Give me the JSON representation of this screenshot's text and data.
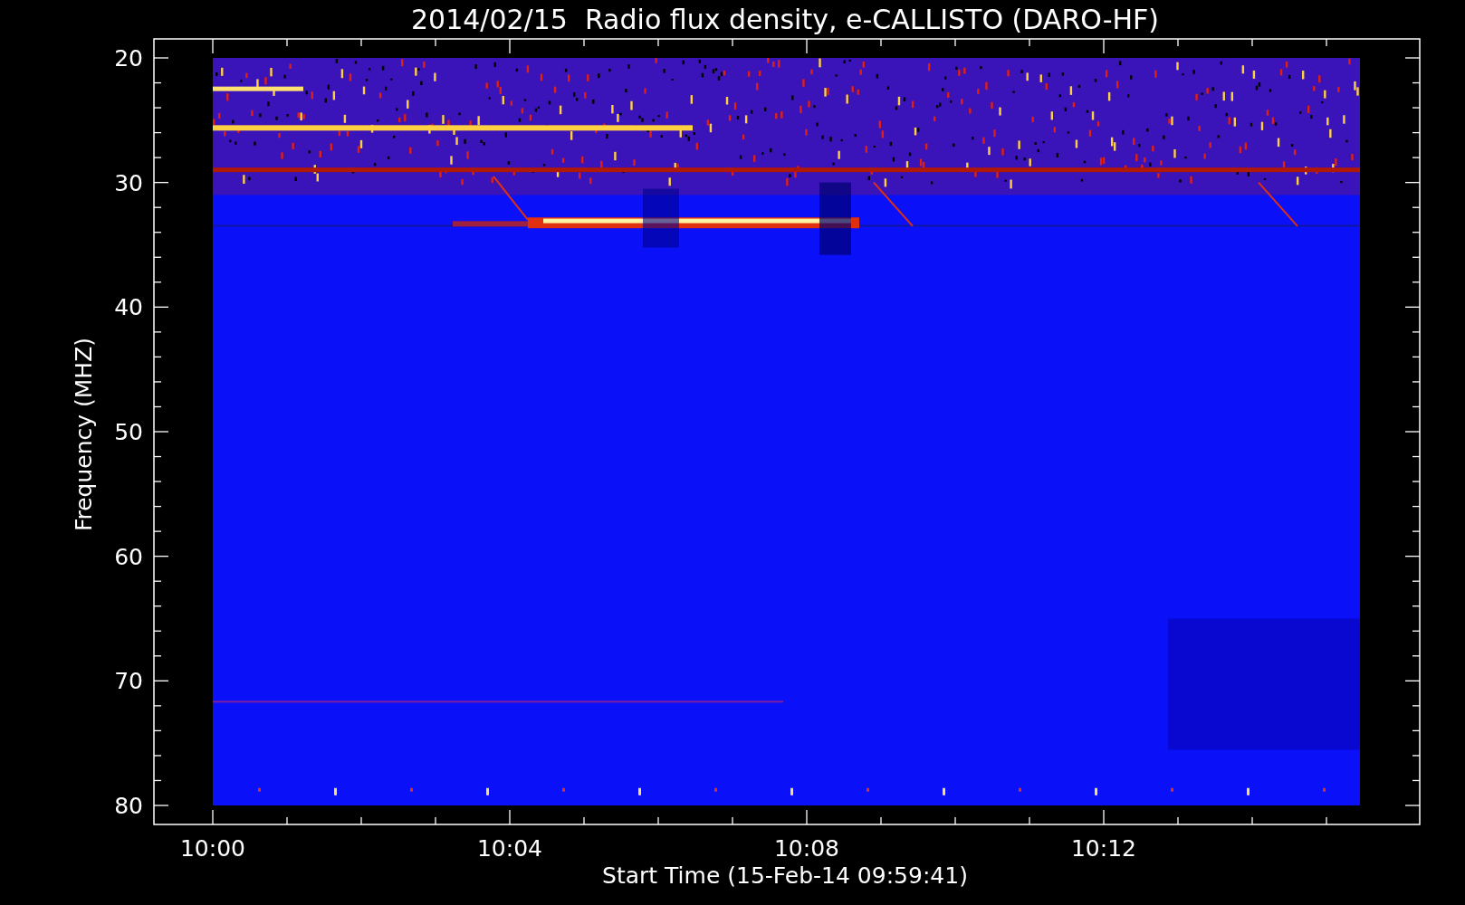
{
  "plot": {
    "title": "2014/02/15  Radio flux density, e-CALLISTO (DARO-HF)",
    "x_axis": {
      "label": "Start Time (15-Feb-14 09:59:41)",
      "ticks": [
        "10:00",
        "10:04",
        "10:08",
        "10:12"
      ]
    },
    "y_axis": {
      "label": "Frequency (MHZ)",
      "ticks": [
        "20",
        "30",
        "40",
        "50",
        "60",
        "70",
        "80"
      ]
    }
  }
}
